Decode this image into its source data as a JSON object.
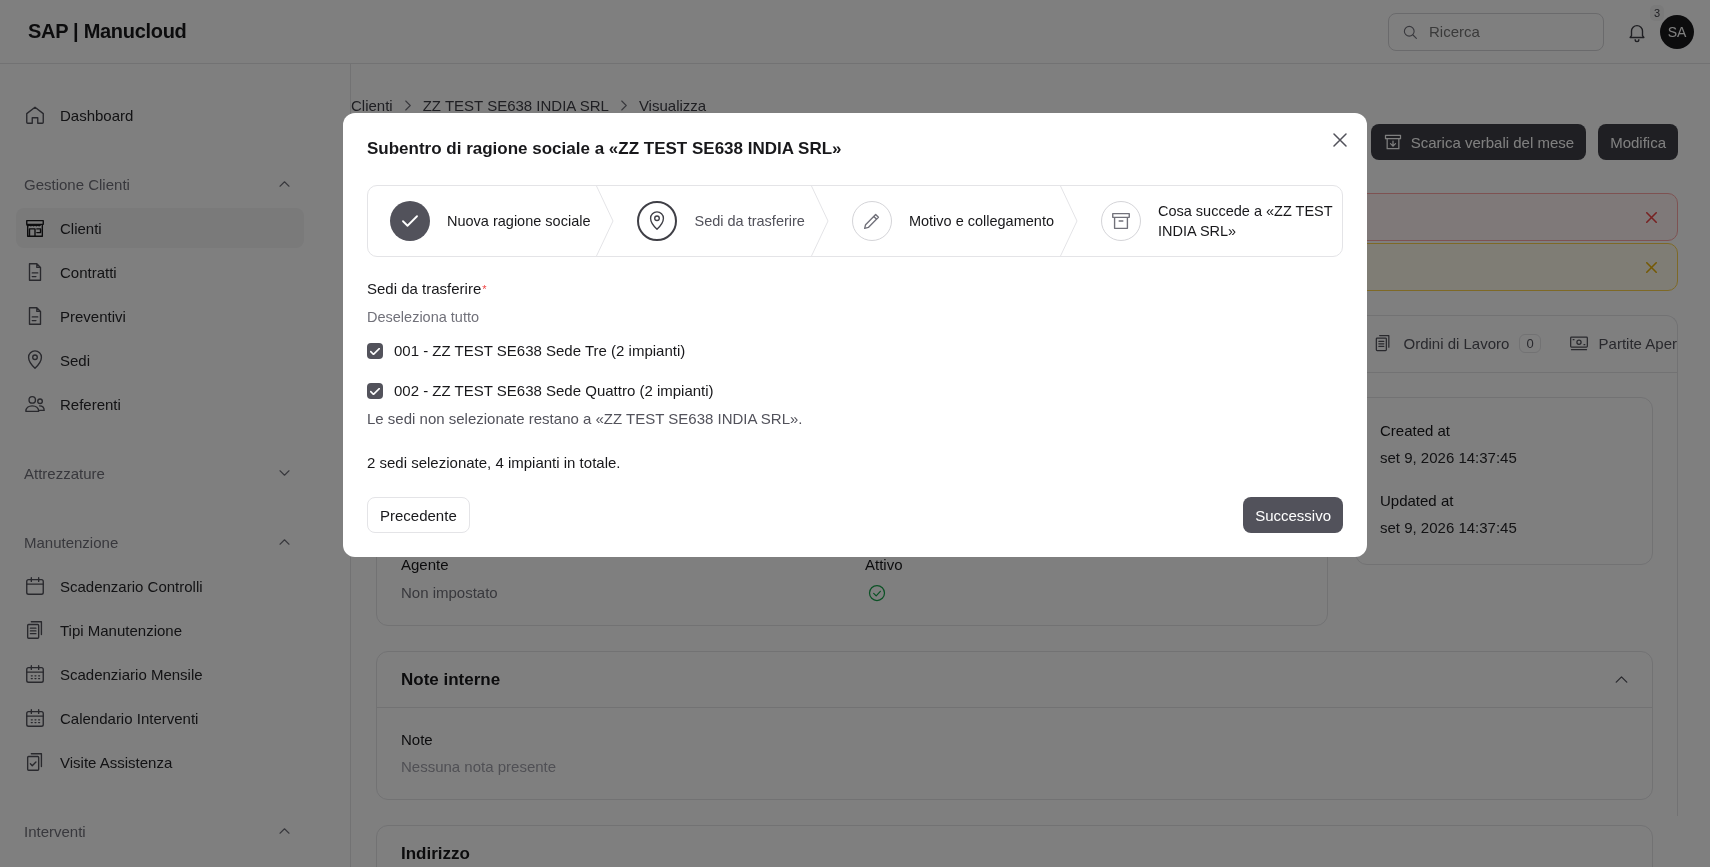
{
  "header": {
    "logo": "SAP | Manucloud",
    "search": {
      "placeholder": "Ricerca"
    },
    "notification_count": "3",
    "avatar": "SA"
  },
  "sidebar": {
    "items": [
      {
        "kind": "link",
        "label": "Dashboard",
        "selected": false
      },
      {
        "kind": "group",
        "label": "Gestione Clienti",
        "expanded": true,
        "children": [
          {
            "kind": "link",
            "label": "Clienti",
            "selected": true
          },
          {
            "kind": "link",
            "label": "Contratti",
            "selected": false
          },
          {
            "kind": "link",
            "label": "Preventivi",
            "selected": false
          },
          {
            "kind": "link",
            "label": "Sedi",
            "selected": false
          },
          {
            "kind": "link",
            "label": "Referenti",
            "selected": false
          }
        ]
      },
      {
        "kind": "group",
        "label": "Attrezzature",
        "expanded": false
      },
      {
        "kind": "group",
        "label": "Manutenzione",
        "expanded": true,
        "children": [
          {
            "kind": "link",
            "label": "Scadenzario Controlli",
            "selected": false
          },
          {
            "kind": "link",
            "label": "Tipi Manutenzione",
            "selected": false
          },
          {
            "kind": "link",
            "label": "Scadenziario Mensile",
            "selected": false
          },
          {
            "kind": "link",
            "label": "Calendario Interventi",
            "selected": false
          },
          {
            "kind": "link",
            "label": "Visite Assistenza",
            "selected": false
          }
        ]
      },
      {
        "kind": "group",
        "label": "Interventi",
        "expanded": true
      }
    ]
  },
  "breadcrumb": [
    "Clienti",
    "ZZ TEST SE638 INDIA SRL",
    "Visualizza"
  ],
  "actions": [
    "Scarica verbali del mese",
    "Modifica"
  ],
  "alerts": [
    {
      "kind": "error"
    },
    {
      "kind": "warning"
    }
  ],
  "tabs": [
    {
      "label": "Ordini di Lavoro",
      "count": "0",
      "selected": false
    },
    {
      "label": "Partite Aper",
      "selected": false
    }
  ],
  "details": [
    {
      "label": "Agente",
      "kind": "text",
      "value": "Non impostato"
    },
    {
      "label": "Attivo",
      "kind": "boolean",
      "value": true
    }
  ],
  "meta": [
    {
      "label": "Created at",
      "value": "set 9, 2026 14:37:45"
    },
    {
      "label": "Updated at",
      "value": "set 9, 2026 14:37:45"
    }
  ],
  "note_section": {
    "title": "Note interne",
    "expanded": true,
    "field_label": "Note",
    "value": "Nessuna nota presente"
  },
  "address_section": {
    "title": "Indirizzo"
  },
  "modal": {
    "title": "Subentro di ragione sociale a «ZZ TEST SE638 INDIA SRL»",
    "steps": [
      {
        "label": "Nuova ragione sociale",
        "completed": true,
        "selected": false
      },
      {
        "label": "Sedi da trasferire",
        "completed": false,
        "selected": true
      },
      {
        "label": "Motivo e collegamento",
        "completed": false,
        "selected": false
      },
      {
        "label": "Cosa succede a «ZZ TEST INDIA SRL»",
        "completed": false,
        "selected": false
      }
    ],
    "field_label": "Sedi da trasferire",
    "required_mark": "*",
    "toggle_link": "Deseleziona tutto",
    "options": [
      {
        "label": "001 - ZZ TEST SE638 Sede Tre (2 impianti)",
        "checked": true
      },
      {
        "label": "002 - ZZ TEST SE638 Sede Quattro (2 impianti)",
        "checked": true
      }
    ],
    "hint": "Le sedi non selezionate restano a «ZZ TEST SE638 INDIA SRL».",
    "summary": "2 sedi selezionate, 4 impianti in totale.",
    "buttons": [
      {
        "label": "Precedente",
        "kind": "secondary"
      },
      {
        "label": "Successivo",
        "kind": "primary"
      }
    ]
  }
}
